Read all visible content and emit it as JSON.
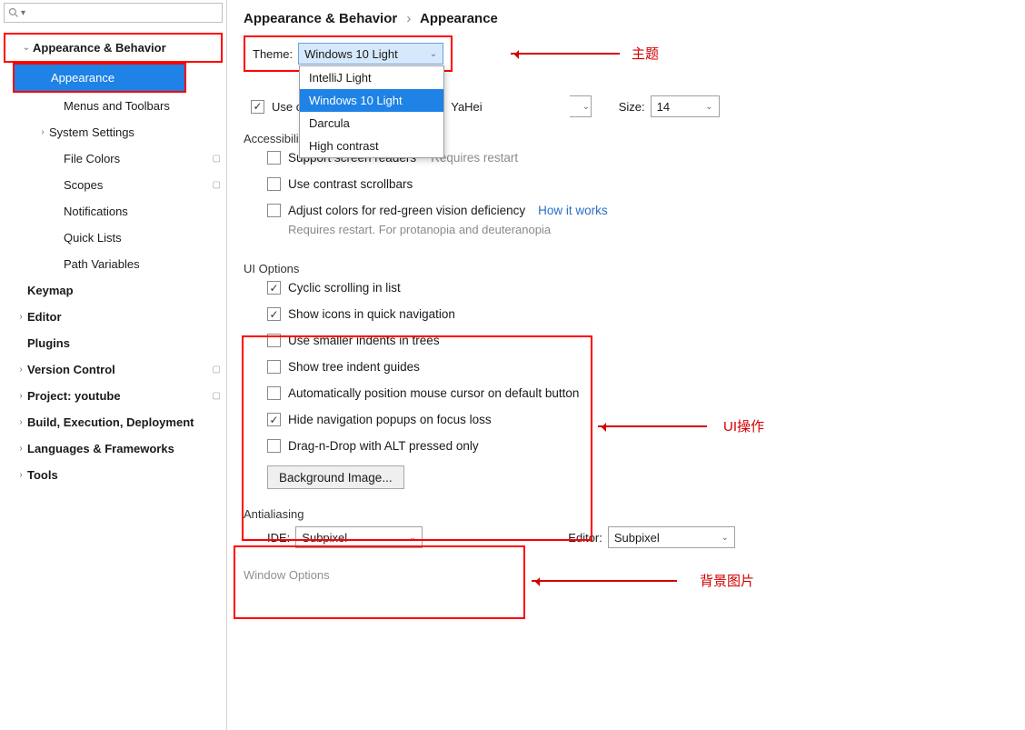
{
  "search": {
    "placeholder": ""
  },
  "sidebar": {
    "appearance_behavior": "Appearance & Behavior",
    "appearance": "Appearance",
    "menus_toolbars": "Menus and Toolbars",
    "system_settings": "System Settings",
    "file_colors": "File Colors",
    "scopes": "Scopes",
    "notifications": "Notifications",
    "quick_lists": "Quick Lists",
    "path_variables": "Path Variables",
    "keymap": "Keymap",
    "editor": "Editor",
    "plugins": "Plugins",
    "version_control": "Version Control",
    "project": "Project: youtube",
    "build": "Build, Execution, Deployment",
    "languages": "Languages & Frameworks",
    "tools": "Tools"
  },
  "breadcrumb": {
    "root": "Appearance & Behavior",
    "leaf": "Appearance"
  },
  "theme": {
    "label": "Theme:",
    "value": "Windows 10 Light",
    "options": [
      "IntelliJ Light",
      "Windows 10 Light",
      "Darcula",
      "High contrast"
    ]
  },
  "font": {
    "use_custom": "Use c",
    "family_suffix": "YaHei",
    "size_label": "Size:",
    "size_value": "14"
  },
  "accessibility": {
    "title": "Accessibility",
    "screen_readers": "Support screen readers",
    "screen_readers_hint": "Requires restart",
    "contrast_scrollbars": "Use contrast scrollbars",
    "color_deficiency": "Adjust colors for red-green vision deficiency",
    "how_link": "How it works",
    "color_hint": "Requires restart. For protanopia and deuteranopia"
  },
  "ui_options": {
    "title": "UI Options",
    "cyclic": "Cyclic scrolling in list",
    "show_icons": "Show icons in quick navigation",
    "smaller_indents": "Use smaller indents in trees",
    "tree_guides": "Show tree indent guides",
    "auto_mouse": "Automatically position mouse cursor on default button",
    "hide_nav": "Hide navigation popups on focus loss",
    "drag_alt": "Drag-n-Drop with ALT pressed only",
    "bg_image": "Background Image..."
  },
  "antialiasing": {
    "title": "Antialiasing",
    "ide_label": "IDE:",
    "ide_value": "Subpixel",
    "editor_label": "Editor:",
    "editor_value": "Subpixel"
  },
  "window_options": {
    "title": "Window Options"
  },
  "annotations": {
    "theme": "主题",
    "ui": "UI操作",
    "bg": "背景图片"
  }
}
